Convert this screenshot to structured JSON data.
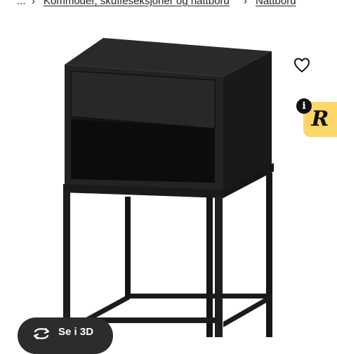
{
  "breadcrumb": {
    "ellipsis": "...",
    "separator": "›",
    "items": [
      "Kommoder, skuffeseksjoner og nattbord",
      "Nattbord"
    ]
  },
  "product_image": {
    "description": "black nightstand"
  },
  "favourite": {
    "icon": "heart-outline-icon"
  },
  "rebuy": {
    "info_glyph": "i",
    "logo_letter": "R"
  },
  "view_3d": {
    "label": "Se i 3D",
    "icon": "rotate-3d-icon"
  },
  "colors": {
    "furniture": "#1f1f1f",
    "badge": "#fcd667",
    "button": "#2c2c2c"
  }
}
